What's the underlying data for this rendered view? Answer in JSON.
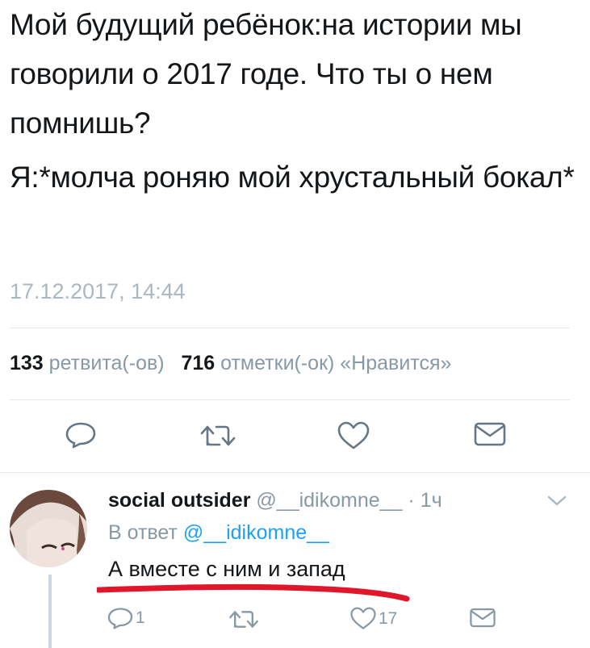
{
  "tweet": {
    "text_line1": "Мой будущий ребёнок:на истории мы говорили о 2017 годе. Что ты о нем помнишь?",
    "text_line2": "Я:*молча роняю мой хрустальный бокал*",
    "timestamp": "17.12.2017, 14:44",
    "retweet_count": "133",
    "retweet_label": "ретвита(-ов)",
    "like_count": "716",
    "like_label": "отметки(-ок) «Нравится»",
    "actions": [
      "reply-icon",
      "retweet-icon",
      "like-icon",
      "message-icon"
    ]
  },
  "reply": {
    "display_name": "social outsider",
    "handle": "@__idikomne__",
    "dot": "·",
    "time": "1ч",
    "reply_prefix": "В ответ",
    "reply_to": "@__idikomne__",
    "text": "А вместе с ним и запад",
    "reply_count": "1",
    "like_count": "17",
    "actions": [
      "reply-icon",
      "retweet-icon",
      "like-icon",
      "message-icon",
      "chevron-down-icon"
    ]
  },
  "colors": {
    "text": "#14171a",
    "secondary": "#8899a6",
    "timestamp": "#aab8c2",
    "link": "#1da1f2",
    "divider": "#e1e8ed",
    "highlight_underline": "#e0162b"
  }
}
